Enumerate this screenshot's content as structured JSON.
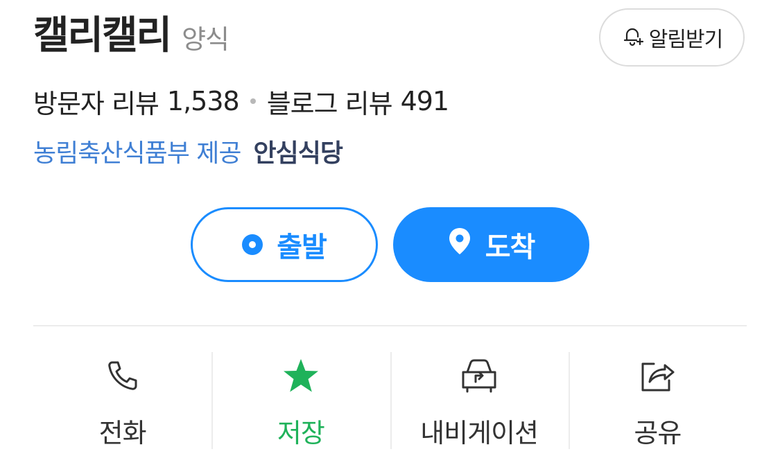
{
  "place": {
    "name": "캘리캘리",
    "category": "양식"
  },
  "alarm_button": {
    "label": "알림받기",
    "icon": "bell-plus-icon"
  },
  "reviews": {
    "visitor_label": "방문자 리뷰",
    "visitor_count": "1,538",
    "blog_label": "블로그 리뷰",
    "blog_count": "491"
  },
  "provider": {
    "org": "농림축산식품부 제공",
    "badge": "안심식당"
  },
  "route": {
    "depart_label": "출발",
    "arrive_label": "도착"
  },
  "actions": [
    {
      "label": "전화",
      "icon": "phone-icon"
    },
    {
      "label": "저장",
      "icon": "star-icon",
      "active": true
    },
    {
      "label": "내비게이션",
      "icon": "car-navigation-icon"
    },
    {
      "label": "공유",
      "icon": "share-icon"
    }
  ],
  "colors": {
    "accent": "#1a8cff",
    "provider_link": "#3f7fd4",
    "saved_green": "#1fb25a",
    "badge_text": "#33405f"
  }
}
